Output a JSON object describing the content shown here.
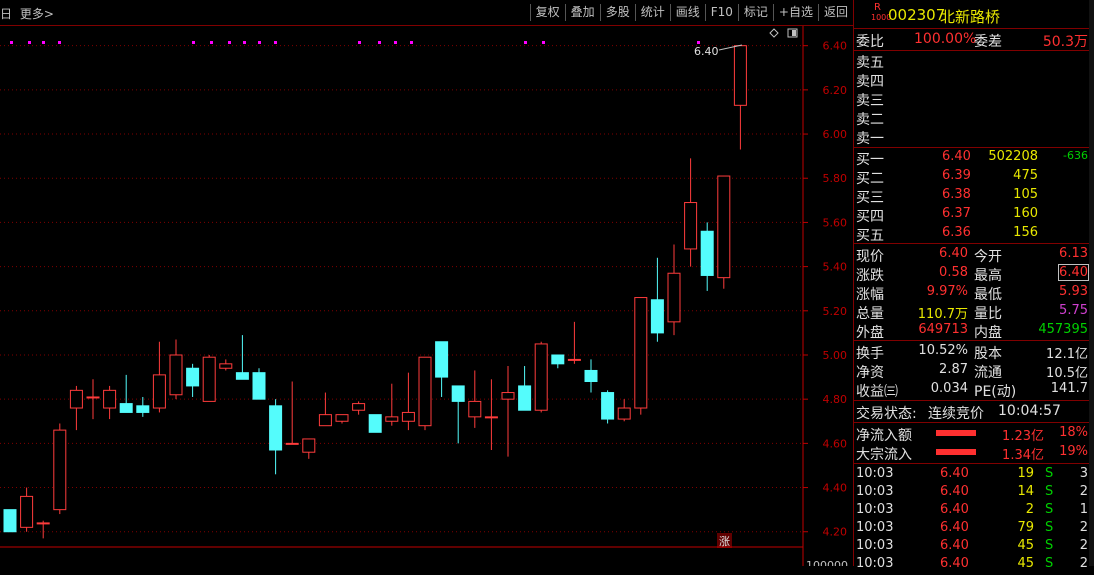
{
  "topbar": {
    "left_items": [
      "日",
      "更多>"
    ],
    "toolbar": [
      "复权",
      "叠加",
      "多股",
      "统计",
      "画线",
      "F10",
      "标记",
      "+自选",
      "返回"
    ]
  },
  "chart_data": {
    "type": "candlestick",
    "y_ticks": [
      "6.40",
      "6.20",
      "6.00",
      "5.80",
      "5.60",
      "5.40",
      "5.20",
      "5.00",
      "4.80",
      "4.60",
      "4.40",
      "4.20"
    ],
    "ylim": [
      4.14,
      6.48
    ],
    "bottom_label": "100000",
    "last_price_label": "6.40",
    "badge": "涨",
    "candles": [
      {
        "o": 4.3,
        "h": 4.3,
        "l": 4.2,
        "c": 4.2
      },
      {
        "o": 4.22,
        "h": 4.4,
        "l": 4.2,
        "c": 4.36
      },
      {
        "o": 4.24,
        "h": 4.25,
        "l": 4.17,
        "c": 4.24
      },
      {
        "o": 4.3,
        "h": 4.69,
        "l": 4.28,
        "c": 4.66
      },
      {
        "o": 4.76,
        "h": 4.86,
        "l": 4.66,
        "c": 4.84
      },
      {
        "o": 4.81,
        "h": 4.89,
        "l": 4.71,
        "c": 4.81
      },
      {
        "o": 4.76,
        "h": 4.86,
        "l": 4.71,
        "c": 4.84
      },
      {
        "o": 4.78,
        "h": 4.91,
        "l": 4.74,
        "c": 4.74
      },
      {
        "o": 4.77,
        "h": 4.81,
        "l": 4.72,
        "c": 4.74
      },
      {
        "o": 4.76,
        "h": 5.06,
        "l": 4.74,
        "c": 4.91
      },
      {
        "o": 4.82,
        "h": 5.07,
        "l": 4.8,
        "c": 5.0
      },
      {
        "o": 4.94,
        "h": 4.96,
        "l": 4.81,
        "c": 4.86
      },
      {
        "o": 4.79,
        "h": 5.0,
        "l": 4.79,
        "c": 4.99
      },
      {
        "o": 4.94,
        "h": 4.98,
        "l": 4.93,
        "c": 4.96
      },
      {
        "o": 4.92,
        "h": 5.09,
        "l": 4.89,
        "c": 4.89
      },
      {
        "o": 4.92,
        "h": 4.94,
        "l": 4.8,
        "c": 4.8
      },
      {
        "o": 4.77,
        "h": 4.8,
        "l": 4.46,
        "c": 4.57
      },
      {
        "o": 4.6,
        "h": 4.88,
        "l": 4.6,
        "c": 4.6
      },
      {
        "o": 4.56,
        "h": 4.62,
        "l": 4.53,
        "c": 4.62
      },
      {
        "o": 4.68,
        "h": 4.83,
        "l": 4.68,
        "c": 4.73
      },
      {
        "o": 4.7,
        "h": 4.73,
        "l": 4.69,
        "c": 4.73
      },
      {
        "o": 4.75,
        "h": 4.79,
        "l": 4.73,
        "c": 4.78
      },
      {
        "o": 4.73,
        "h": 4.73,
        "l": 4.65,
        "c": 4.65
      },
      {
        "o": 4.7,
        "h": 4.87,
        "l": 4.68,
        "c": 4.72
      },
      {
        "o": 4.7,
        "h": 4.92,
        "l": 4.66,
        "c": 4.74
      },
      {
        "o": 4.68,
        "h": 4.99,
        "l": 4.66,
        "c": 4.99
      },
      {
        "o": 5.06,
        "h": 5.06,
        "l": 4.81,
        "c": 4.9
      },
      {
        "o": 4.86,
        "h": 4.86,
        "l": 4.6,
        "c": 4.79
      },
      {
        "o": 4.72,
        "h": 4.93,
        "l": 4.67,
        "c": 4.79
      },
      {
        "o": 4.72,
        "h": 4.89,
        "l": 4.57,
        "c": 4.72
      },
      {
        "o": 4.8,
        "h": 4.95,
        "l": 4.54,
        "c": 4.83
      },
      {
        "o": 4.86,
        "h": 4.95,
        "l": 4.76,
        "c": 4.75
      },
      {
        "o": 4.75,
        "h": 5.06,
        "l": 4.74,
        "c": 5.05
      },
      {
        "o": 5.0,
        "h": 5.0,
        "l": 4.94,
        "c": 4.96
      },
      {
        "o": 4.98,
        "h": 5.15,
        "l": 4.96,
        "c": 4.98
      },
      {
        "o": 4.93,
        "h": 4.98,
        "l": 4.83,
        "c": 4.88
      },
      {
        "o": 4.83,
        "h": 4.84,
        "l": 4.69,
        "c": 4.71
      },
      {
        "o": 4.71,
        "h": 4.8,
        "l": 4.7,
        "c": 4.76
      },
      {
        "o": 4.76,
        "h": 5.26,
        "l": 4.73,
        "c": 5.26
      },
      {
        "o": 5.25,
        "h": 5.44,
        "l": 5.06,
        "c": 5.1
      },
      {
        "o": 5.15,
        "h": 5.5,
        "l": 5.09,
        "c": 5.37
      },
      {
        "o": 5.48,
        "h": 5.89,
        "l": 5.4,
        "c": 5.69
      },
      {
        "o": 5.56,
        "h": 5.6,
        "l": 5.29,
        "c": 5.36
      },
      {
        "o": 5.35,
        "h": 5.81,
        "l": 5.3,
        "c": 5.81
      },
      {
        "o": 6.13,
        "h": 6.4,
        "l": 5.93,
        "c": 6.4
      }
    ]
  },
  "stock": {
    "code_prefix": "R",
    "code_sub": "1000",
    "code": "002307",
    "name": "北新路桥"
  },
  "order_book": {
    "weibi_label": "委比",
    "weibi_value": "100.00%",
    "weicha_label": "委差",
    "weicha_value": "50.3万",
    "sells": [
      "卖五",
      "卖四",
      "卖三",
      "卖二",
      "卖一"
    ],
    "buys": [
      {
        "label": "买一",
        "price": "6.40",
        "vol": "502208",
        "chg": "-636"
      },
      {
        "label": "买二",
        "price": "6.39",
        "vol": "475",
        "chg": ""
      },
      {
        "label": "买三",
        "price": "6.38",
        "vol": "105",
        "chg": ""
      },
      {
        "label": "买四",
        "price": "6.37",
        "vol": "160",
        "chg": ""
      },
      {
        "label": "买五",
        "price": "6.36",
        "vol": "156",
        "chg": ""
      }
    ]
  },
  "quote": [
    {
      "l1": "现价",
      "v1": "6.40",
      "l2": "今开",
      "v2": "6.13",
      "c1": "red",
      "c2": "red"
    },
    {
      "l1": "涨跌",
      "v1": "0.58",
      "l2": "最高",
      "v2": "6.40",
      "c1": "red",
      "c2": "red"
    },
    {
      "l1": "涨幅",
      "v1": "9.97%",
      "l2": "最低",
      "v2": "5.93",
      "c1": "red",
      "c2": "red"
    },
    {
      "l1": "总量",
      "v1": "110.7万",
      "l2": "量比",
      "v2": "5.75",
      "c1": "yellow",
      "c2": "purple"
    },
    {
      "l1": "外盘",
      "v1": "649713",
      "l2": "内盘",
      "v2": "457395",
      "c1": "red",
      "c2": "green"
    }
  ],
  "stats": [
    {
      "l1": "换手",
      "v1": "10.52%",
      "l2": "股本",
      "v2": "12.1亿"
    },
    {
      "l1": "净资",
      "v1": "2.87",
      "l2": "流通",
      "v2": "10.5亿"
    },
    {
      "l1": "收益㈢",
      "v1": "0.034",
      "l2": "PE(动)",
      "v2": "141.7"
    }
  ],
  "trade_status": {
    "label": "交易状态:",
    "value": "连续竞价",
    "time": "10:04:57"
  },
  "flows": [
    {
      "label": "净流入额",
      "value": "1.23亿",
      "pct": "18%"
    },
    {
      "label": "大宗流入",
      "value": "1.34亿",
      "pct": "19%"
    }
  ],
  "ticks": [
    {
      "time": "10:03",
      "price": "6.40",
      "vol": "19",
      "side": "S",
      "n": "3"
    },
    {
      "time": "10:03",
      "price": "6.40",
      "vol": "14",
      "side": "S",
      "n": "2"
    },
    {
      "time": "10:03",
      "price": "6.40",
      "vol": "2",
      "side": "S",
      "n": "1"
    },
    {
      "time": "10:03",
      "price": "6.40",
      "vol": "79",
      "side": "S",
      "n": "2"
    },
    {
      "time": "10:03",
      "price": "6.40",
      "vol": "45",
      "side": "S",
      "n": "2"
    },
    {
      "time": "10:03",
      "price": "6.40",
      "vol": "45",
      "side": "S",
      "n": "2"
    }
  ],
  "colors": {
    "up": "#ff3c3c",
    "down": "#54fcfc",
    "grid": "#800000",
    "axis": "#c00000",
    "marker": "#ff00ff"
  }
}
